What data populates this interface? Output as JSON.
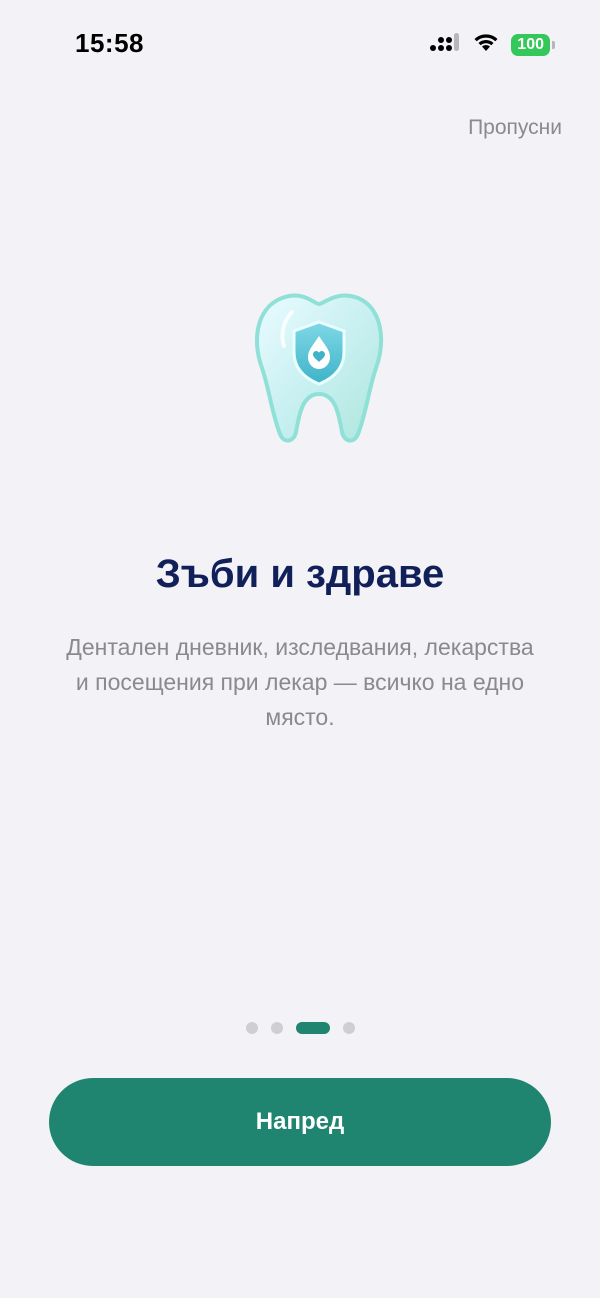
{
  "status_bar": {
    "time": "15:58",
    "battery": "100",
    "icons": [
      "cellular-signal-icon",
      "wifi-icon",
      "battery-icon"
    ]
  },
  "onboarding": {
    "skip_label": "Пропусни",
    "illustration": "tooth-shield-icon",
    "title": "Зъби и здраве",
    "subtitle": "Дентален дневник, изследвания, лекарства и посещения при лекар — всичко на едно място.",
    "page_count": 4,
    "active_page": 3,
    "next_label": "Напред"
  },
  "colors": {
    "background": "#f2f2f7",
    "accent": "#1f8570",
    "title": "#12205a",
    "secondary_text": "#8a8a8e",
    "battery": "#34c759"
  }
}
